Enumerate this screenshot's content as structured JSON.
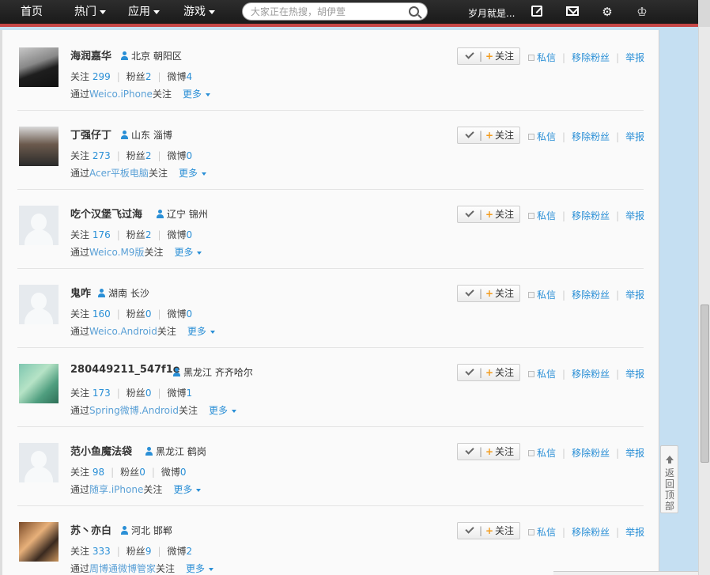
{
  "nav": {
    "home": "首页",
    "hot": "热门",
    "apps": "应用",
    "games": "游戏",
    "search_placeholder": "大家正在热搜，胡伊萱",
    "user_name": "岁月就是..."
  },
  "fans": [
    {
      "name": "海润嘉华",
      "location": "北京 朝阳区",
      "following_label": "关注",
      "following": "299",
      "fans_label": "粉丝",
      "fans": "2",
      "weibo_label": "微博",
      "weibo": "4",
      "via_prefix": "通过",
      "via_app": "Weico.iPhone",
      "via_suffix": "关注",
      "more": "更多"
    },
    {
      "name": "丁强仔丁",
      "location": "山东 淄博",
      "following_label": "关注",
      "following": "273",
      "fans_label": "粉丝",
      "fans": "2",
      "weibo_label": "微博",
      "weibo": "0",
      "via_prefix": "通过",
      "via_app": "Acer平板电脑",
      "via_suffix": "关注",
      "more": "更多"
    },
    {
      "name": "吃个汉堡飞过海",
      "location": "辽宁 锦州",
      "following_label": "关注",
      "following": "176",
      "fans_label": "粉丝",
      "fans": "2",
      "weibo_label": "微博",
      "weibo": "0",
      "via_prefix": "通过",
      "via_app": "Weico.M9版",
      "via_suffix": "关注",
      "more": "更多"
    },
    {
      "name": "鬼咋",
      "location": "湖南 长沙",
      "following_label": "关注",
      "following": "160",
      "fans_label": "粉丝",
      "fans": "0",
      "weibo_label": "微博",
      "weibo": "0",
      "via_prefix": "通过",
      "via_app": "Weico.Android",
      "via_suffix": "关注",
      "more": "更多"
    },
    {
      "name": "280449211_547f1e",
      "location": "黑龙江 齐齐哈尔",
      "following_label": "关注",
      "following": "173",
      "fans_label": "粉丝",
      "fans": "0",
      "weibo_label": "微博",
      "weibo": "1",
      "via_prefix": "通过",
      "via_app": "Spring微博.Android",
      "via_suffix": "关注",
      "more": "更多"
    },
    {
      "name": "范小鱼魔法袋",
      "location": "黑龙江 鹤岗",
      "following_label": "关注",
      "following": "98",
      "fans_label": "粉丝",
      "fans": "0",
      "weibo_label": "微博",
      "weibo": "0",
      "via_prefix": "通过",
      "via_app": "随享.iPhone",
      "via_suffix": "关注",
      "more": "更多"
    },
    {
      "name": "苏丶亦白",
      "location": "河北 邯郸",
      "following_label": "关注",
      "following": "333",
      "fans_label": "粉丝",
      "fans": "9",
      "weibo_label": "微博",
      "weibo": "2",
      "via_prefix": "通过",
      "via_app": "周博通微博管家",
      "via_suffix": "关注",
      "more": "更多"
    }
  ],
  "actions": {
    "follow": "关注",
    "bar": "|",
    "plus": "+",
    "message": "私信",
    "remove_fan": "移除粉丝",
    "report": "举报"
  },
  "back_to_top": "返回顶部"
}
